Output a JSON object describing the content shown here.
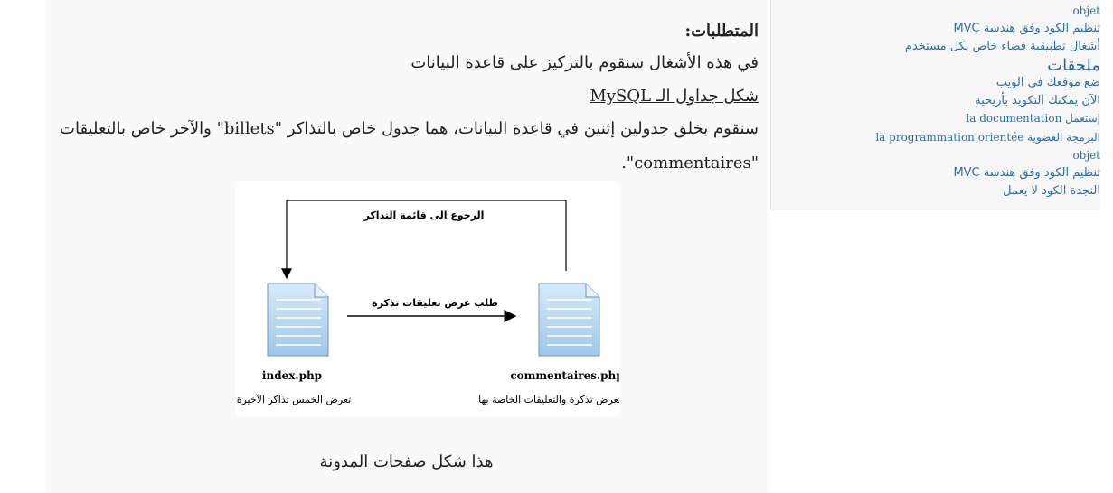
{
  "main": {
    "requirements_title": "المتطلبات:",
    "intro": "في هذه الأشغال سنقوم بالتركيز على قاعدة البيانات",
    "tables_link": "شكل جداول الـ MySQL",
    "description_line1": "سنقوم بخلق جدولين إثنين في قاعدة البيانات، هما جدول خاص بالتذاكر \"billets\" والآخر خاص بالتعليقات",
    "description_line2": "\"commentaires\".",
    "caption": "هذا شكل صفحات المدونة"
  },
  "diagram": {
    "back_label": "الرجوع الى قائمة التذاكر",
    "request_label": "طلب عرض تعليقات تذكرة",
    "left_file": "index.php",
    "left_desc": "تعرض الخمس تذاكر الآخيرة",
    "right_file": "commentaires.php",
    "right_desc": "تعرض تذكرة والتعليقات الخاصة بها",
    "icon_color": "#a9cdea"
  },
  "sidebar": {
    "items": [
      "objet",
      "تنظيم الكود وفق هندسة MVC",
      "أشغال تطبيقية فضاء خاص بكل مستخدم",
      "ملحقات",
      "ضع موقعك في الويب",
      "الآن يمكنك التكويد بأريحية",
      "إستعمل la documentation",
      "البرمجة العضوية la programmation orientée",
      "objet",
      "تنظيم الكود وفق هندسة MVC",
      "النجدة الكود لا يعمل"
    ]
  }
}
